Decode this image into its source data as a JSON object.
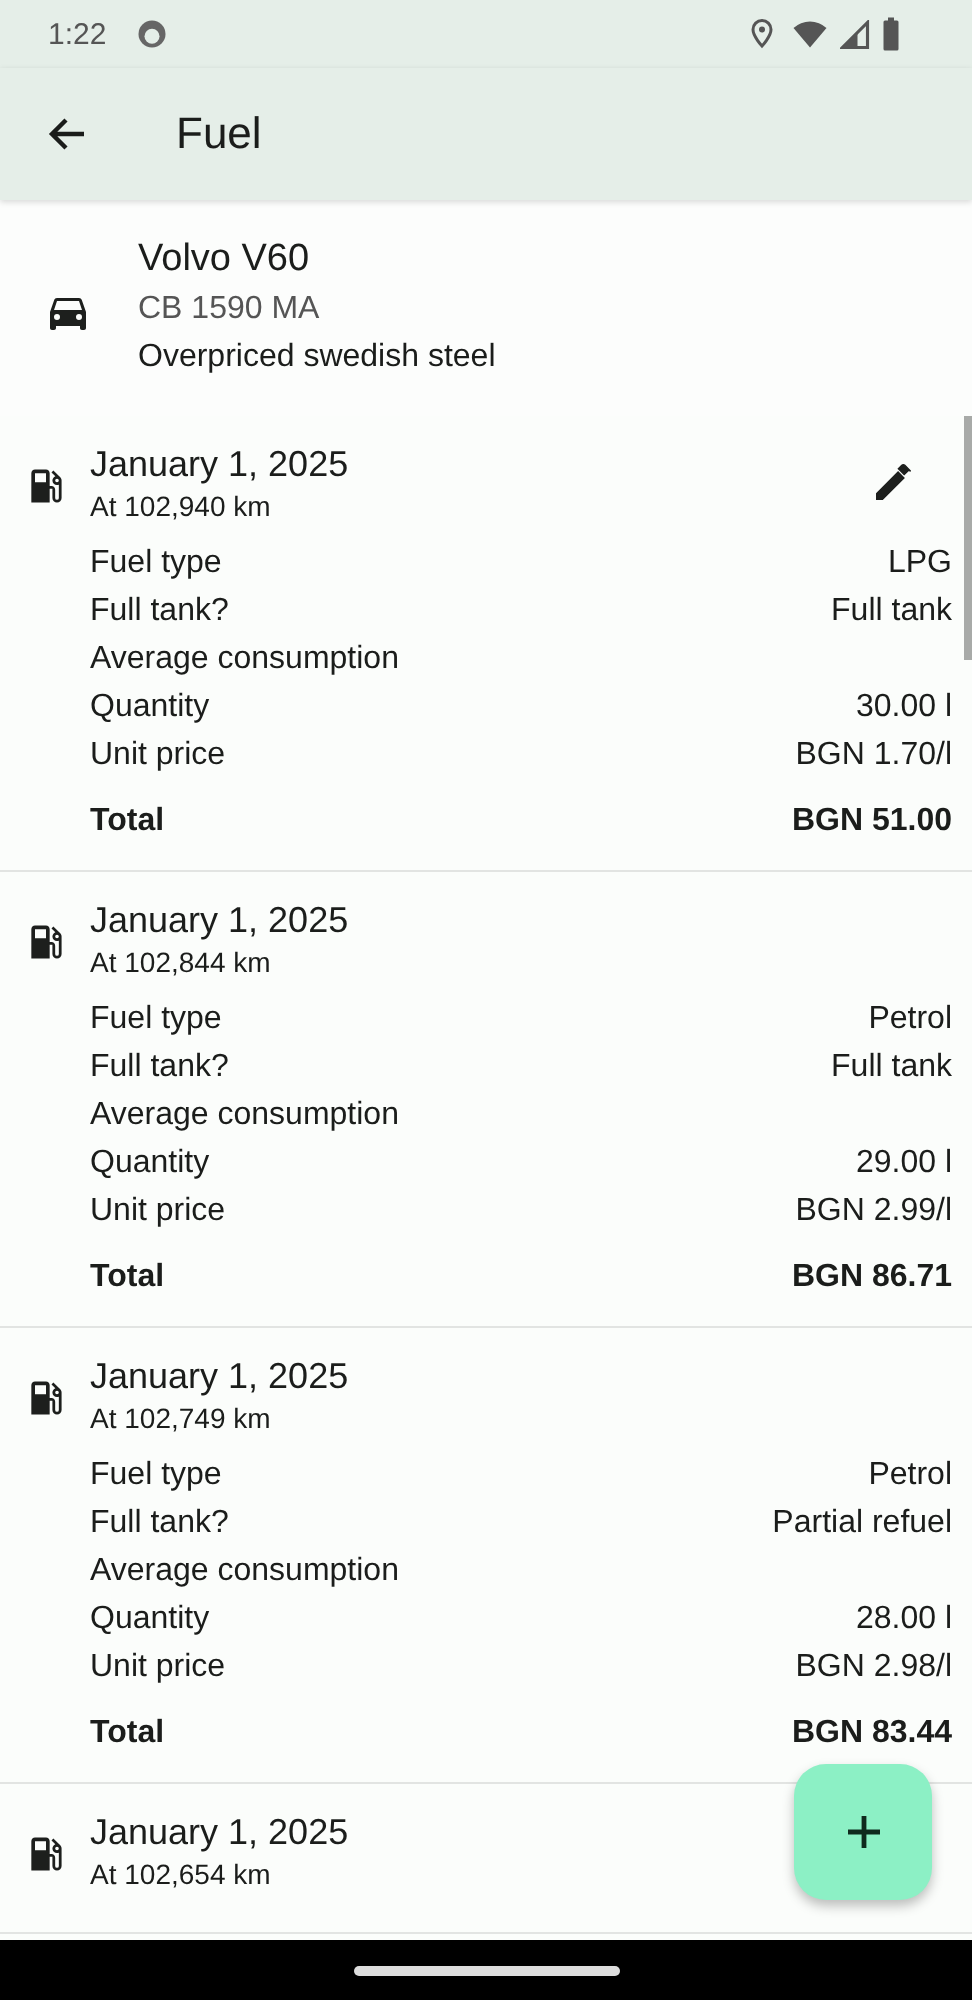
{
  "status_bar": {
    "time": "1:22"
  },
  "app_bar": {
    "title": "Fuel"
  },
  "vehicle": {
    "name": "Volvo V60",
    "plate": "CB 1590 MA",
    "description": "Overpriced swedish steel"
  },
  "entries": [
    {
      "date": "January 1, 2025",
      "odometer": "At 102,940 km",
      "editable": true,
      "rows": [
        {
          "label": "Fuel type",
          "value": "LPG"
        },
        {
          "label": "Full tank?",
          "value": "Full tank"
        },
        {
          "label": "Average consumption"
        },
        {
          "label": "Quantity",
          "value": "30.00 l"
        },
        {
          "label": "Unit price",
          "value": "BGN 1.70/l"
        }
      ],
      "total_label": "Total",
      "total": "BGN 51.00"
    },
    {
      "date": "January 1, 2025",
      "odometer": "At 102,844 km",
      "editable": false,
      "rows": [
        {
          "label": "Fuel type",
          "value": "Petrol"
        },
        {
          "label": "Full tank?",
          "value": "Full tank"
        },
        {
          "label": "Average consumption"
        },
        {
          "label": "Quantity",
          "value": "29.00 l"
        },
        {
          "label": "Unit price",
          "value": "BGN 2.99/l"
        }
      ],
      "total_label": "Total",
      "total": "BGN 86.71"
    },
    {
      "date": "January 1, 2025",
      "odometer": "At 102,749 km",
      "editable": false,
      "rows": [
        {
          "label": "Fuel type",
          "value": "Petrol"
        },
        {
          "label": "Full tank?",
          "value": "Partial refuel"
        },
        {
          "label": "Average consumption"
        },
        {
          "label": "Quantity",
          "value": "28.00 l"
        },
        {
          "label": "Unit price",
          "value": "BGN 2.98/l"
        }
      ],
      "total_label": "Total",
      "total": "BGN 83.44"
    },
    {
      "date": "January 1, 2025",
      "odometer": "At 102,654 km"
    }
  ]
}
